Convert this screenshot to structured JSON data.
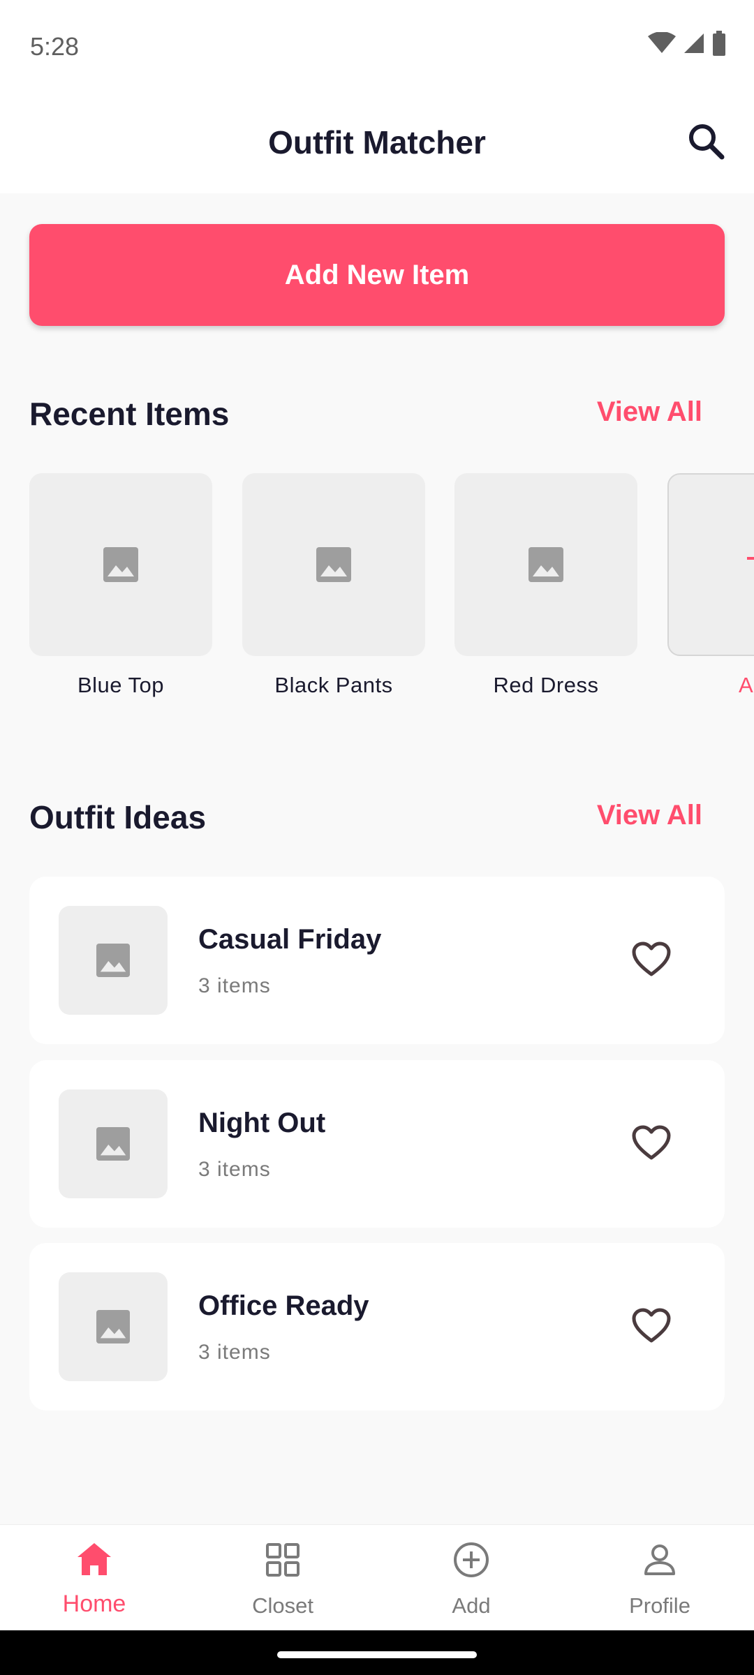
{
  "status_bar": {
    "time": "5:28"
  },
  "app_bar": {
    "title": "Outfit Matcher"
  },
  "add_button": {
    "label": "Add New Item"
  },
  "recent": {
    "title": "Recent Items",
    "view_all": "View All",
    "items": [
      {
        "label": "Blue Top"
      },
      {
        "label": "Black Pants"
      },
      {
        "label": "Red Dress"
      }
    ],
    "add_tile_label": "A"
  },
  "outfits": {
    "title": "Outfit Ideas",
    "view_all": "View All",
    "items": [
      {
        "name": "Casual Friday",
        "count": "3 items"
      },
      {
        "name": "Night Out",
        "count": "3 items"
      },
      {
        "name": "Office Ready",
        "count": "3 items"
      }
    ]
  },
  "nav": {
    "items": [
      {
        "label": "Home",
        "icon": "home-icon",
        "active": true
      },
      {
        "label": "Closet",
        "icon": "grid-icon",
        "active": false
      },
      {
        "label": "Add",
        "icon": "add-circle-icon",
        "active": false
      },
      {
        "label": "Profile",
        "icon": "person-icon",
        "active": false
      }
    ]
  },
  "colors": {
    "accent": "#ff4d6d",
    "text_primary": "#1a1a2e",
    "text_secondary": "#7a7a7a",
    "placeholder_bg": "#eeeeee",
    "heart": "#4a3b3e"
  }
}
